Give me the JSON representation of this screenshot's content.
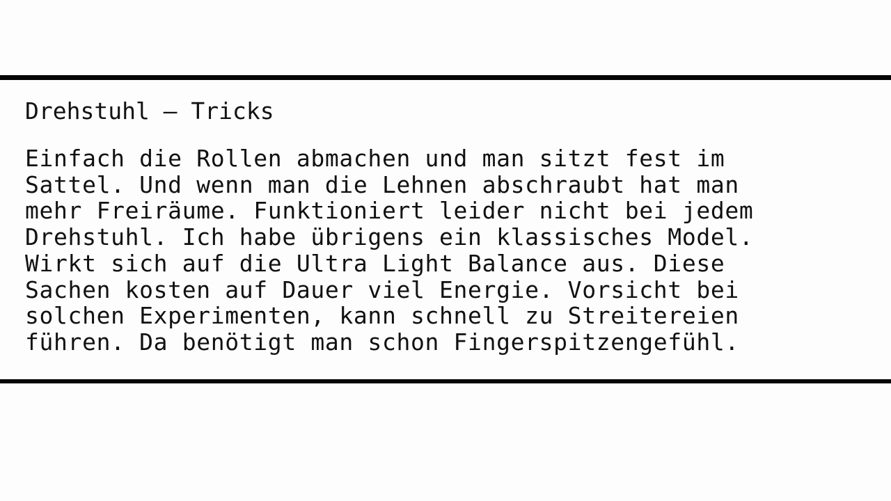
{
  "document": {
    "title": "Drehstuhl – Tricks",
    "lines": [
      "Einfach die Rollen abmachen und man sitzt fest im",
      "Sattel. Und wenn man die Lehnen abschraubt hat man",
      "mehr Freiräume. Funktioniert leider nicht bei jedem",
      "Drehstuhl. Ich habe übrigens ein klassisches Model.",
      "Wirkt sich auf die Ultra Light Balance aus. Diese",
      "Sachen kosten auf Dauer viel Energie. Vorsicht bei",
      "solchen Experimenten, kann schnell zu Streitereien",
      "führen. Da benötigt man schon Fingerspitzengefühl."
    ]
  },
  "colors": {
    "background": "#fdfdfd",
    "text": "#111111",
    "rules": "#050505"
  }
}
